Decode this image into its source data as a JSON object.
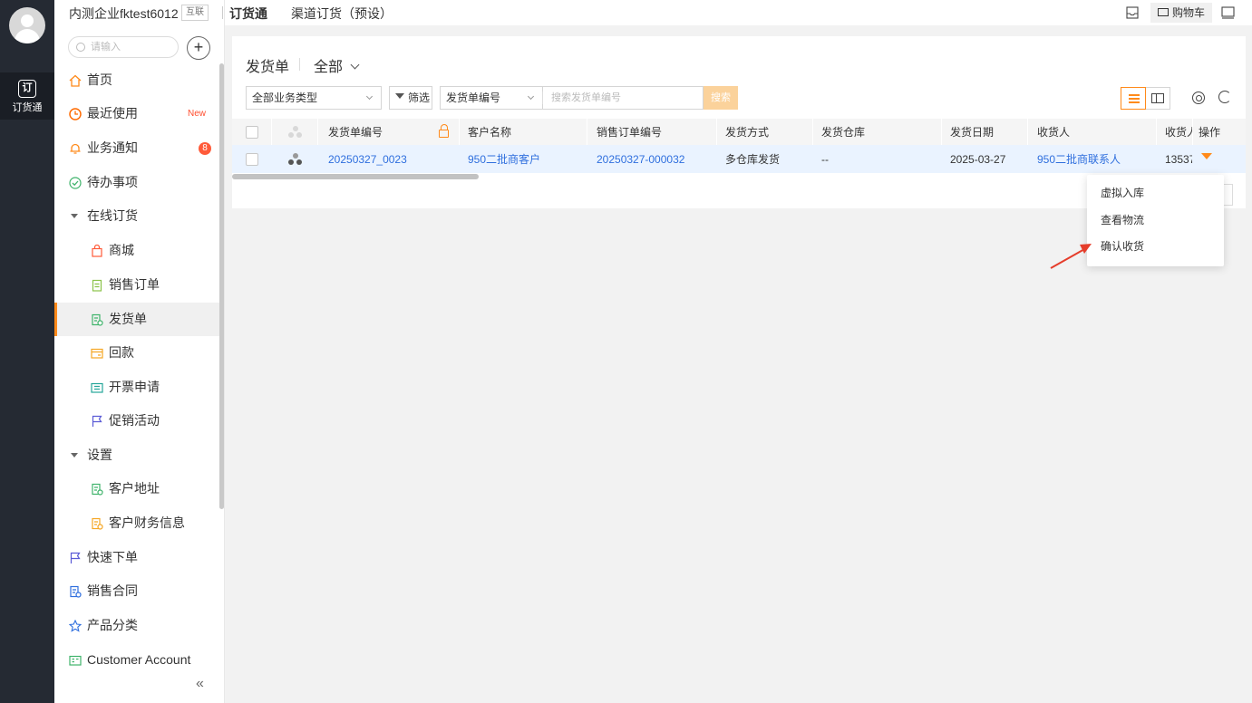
{
  "rail": {
    "app_label": "订货通",
    "app_icon_text": "订"
  },
  "topbar": {
    "company": "内测企业fktest6012",
    "tag": "互联",
    "tabs": [
      "订货通",
      "渠道订货（预设）"
    ],
    "cart_label": "购物车"
  },
  "sidebar": {
    "search_placeholder": "请输入",
    "new_badge": "New",
    "notice_count": "8",
    "items": [
      {
        "label": "首页",
        "icon": "home-icon"
      },
      {
        "label": "最近使用",
        "icon": "clock-icon"
      },
      {
        "label": "业务通知",
        "icon": "bell-icon"
      },
      {
        "label": "待办事项",
        "icon": "check-circle-icon"
      },
      {
        "label": "在线订货",
        "icon": "caret-down-icon"
      },
      {
        "label": "商城",
        "icon": "shopping-bag-icon"
      },
      {
        "label": "销售订单",
        "icon": "clipboard-icon"
      },
      {
        "label": "发货单",
        "icon": "delivery-doc-icon"
      },
      {
        "label": "回款",
        "icon": "payment-icon"
      },
      {
        "label": "开票申请",
        "icon": "invoice-icon"
      },
      {
        "label": "促销活动",
        "icon": "flag-icon"
      },
      {
        "label": "设置",
        "icon": "caret-down-icon"
      },
      {
        "label": "客户地址",
        "icon": "address-doc-icon"
      },
      {
        "label": "客户财务信息",
        "icon": "finance-doc-icon"
      },
      {
        "label": "快速下单",
        "icon": "flag-icon"
      },
      {
        "label": "销售合同",
        "icon": "contract-icon"
      },
      {
        "label": "产品分类",
        "icon": "category-icon"
      },
      {
        "label": "Customer Account",
        "icon": "account-card-icon"
      }
    ],
    "collapse_glyph": "«"
  },
  "main": {
    "title": "发货单",
    "scope": "全部",
    "business_type": "全部业务类型",
    "filter_label": "筛选",
    "search_field": "发货单编号",
    "search_placeholder": "搜索发货单编号",
    "search_button": "搜索",
    "table": {
      "columns": [
        "发货单编号",
        "客户名称",
        "销售订单编号",
        "发货方式",
        "发货仓库",
        "发货日期",
        "收货人",
        "收货人",
        "操作"
      ],
      "rows": [
        {
          "number": "20250327_0023",
          "customer": "950二批商客户",
          "sales_order": "20250327-000032",
          "method": "多仓库发货",
          "warehouse": "--",
          "date": "2025-03-27",
          "receiver": "950二批商联系人",
          "phone": "13537"
        }
      ]
    },
    "action_menu": [
      "虚拟入库",
      "查看物流",
      "确认收货"
    ]
  },
  "colors": {
    "accent": "#ff8a1a",
    "link": "#2f6fde",
    "rail_bg": "#252a33",
    "selected_row": "#eaf3ff"
  }
}
